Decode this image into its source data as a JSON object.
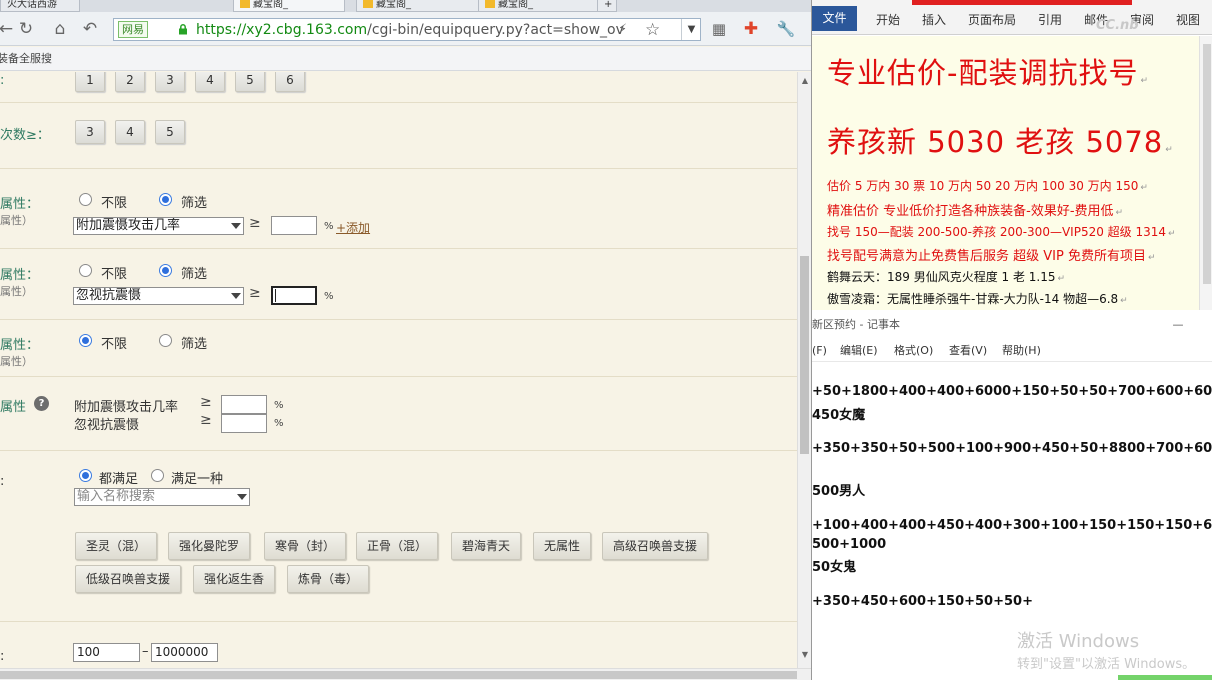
{
  "browser": {
    "tabs": [
      "火大话西游",
      "藏宝阁_",
      "藏宝阁_",
      "藏宝阁_",
      "+"
    ],
    "nav": {
      "back": "←",
      "refresh": "↻",
      "home": "⌂",
      "undo": "↶"
    },
    "url": {
      "site_label": "网易",
      "address": "https://xy2.cbg.163.com/cgi-bin/equipquery.py?act=show_ov",
      "host_part": "https://xy2.cbg.163.com",
      "path_part": "/cgi-bin/equipquery.py?act=show_ov"
    },
    "bookmark_text": "装备全服搜",
    "form": {
      "row1_label": ":",
      "row1_buttons": [
        "1",
        "2",
        "3",
        "4",
        "5",
        "6"
      ],
      "row2_label": "次数≥：",
      "row2_buttons": [
        "3",
        "4",
        "5"
      ],
      "attr1": {
        "label": "属性：",
        "sub": "属性）",
        "opt_none": "不限",
        "opt_filter": "筛选",
        "select": "附加震慑攻击几率",
        "ge": "≥",
        "pct": "%",
        "add_link": "+添加"
      },
      "attr2": {
        "label": "属性：",
        "sub": "属性）",
        "opt_none": "不限",
        "opt_filter": "筛选",
        "select": "忽视抗震慑",
        "ge": "≥",
        "pct": "%"
      },
      "attr3": {
        "label": "属性：",
        "sub": "属性）",
        "opt_none": "不限",
        "opt_filter": "筛选"
      },
      "attr4": {
        "label": "属性",
        "help": "?",
        "items": [
          {
            "name": "附加震慑攻击几率",
            "ge": "≥",
            "pct": "%"
          },
          {
            "name": "忽视抗震慑",
            "ge": "≥",
            "pct": "%"
          }
        ]
      },
      "skills": {
        "label": ":",
        "opt_all": "都满足",
        "opt_any": "满足一种",
        "search_placeholder": "输入名称搜索",
        "tags": [
          "圣灵（混）",
          "强化曼陀罗",
          "寒骨（封）",
          "正骨（混）",
          "碧海青天",
          "无属性",
          "高级召唤兽支援",
          "低级召唤兽支援",
          "强化返生香",
          "炼骨（毒）"
        ]
      },
      "range": {
        "label": ":",
        "min": "100",
        "dash": "–",
        "max": "1000000"
      }
    }
  },
  "word": {
    "tabs": [
      "文件",
      "开始",
      "插入",
      "页面布局",
      "引用",
      "邮件",
      "审阅",
      "视图"
    ],
    "watermark": "CC.nb",
    "lines": [
      "专业估价-配装调抗找号",
      "养孩新 5030 老孩 5078",
      "估价 5 万内 30 票   10 万内 50  20 万内 100  30 万内 150",
      "精准估价  专业低价打造各种族装备-效果好-费用低",
      "找号 150—配装 200-500-养孩 200-300—VIP520 超级 1314",
      "找号配号满意为止免费售后服务   超级 VIP 免费所有项目",
      "鹤舞云天：189 男仙风克火程度 1 老 1.15",
      "傲雪凌霜：无属性睡杀强牛-甘霖-大力队-14 物超—6.8"
    ]
  },
  "notepad": {
    "title": "新区预约 - 记事本",
    "min": "—",
    "menu": [
      "(F)",
      "编辑(E)",
      "格式(O)",
      "查看(V)",
      "帮助(H)"
    ],
    "lines": [
      "+50+1800+400+400+6000+150+50+50+700+600+60",
      "450女魔",
      "",
      "+350+350+50+500+100+900+450+50+8800+700+60",
      "",
      "500男人",
      "",
      "+100+400+400+450+400+300+100+150+150+150+6",
      "500+1000",
      "50女鬼",
      "",
      "+350+450+600+150+50+50+"
    ],
    "activate_title": "激活 Windows",
    "activate_sub": "转到\"设置\"以激活 Windows。"
  }
}
